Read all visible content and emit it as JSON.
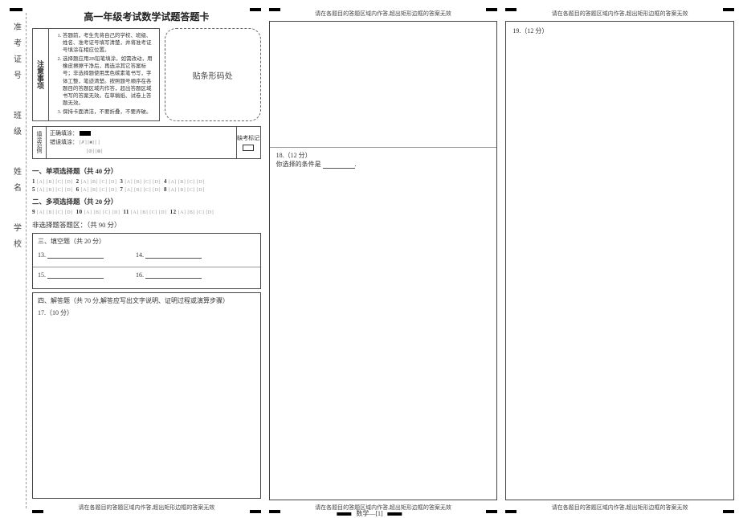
{
  "title": "高一年级考试数学试题答题卡",
  "notice": {
    "label": "注意事项",
    "items": [
      "答题前，考生先将自己的学校、班级、姓名、准考证号填写清楚，并将准考证号填涂在相应位置。",
      "选择题应用2B铅笔填涂，如需改动，用橡皮擦擦干净后，再选涂其它答案标号；非选择题使用黑色碳素笔书写，字体工整，笔迹清楚。按照题号顺序在各题目的答题区域内作答，超出答题区域书写的答案无效。在草稿纸、试卷上答题无效。",
      "保持卡面清洁，不要折叠，不要弄破。"
    ]
  },
  "barcode_label": "贴条形码处",
  "fill_example": {
    "label": "填涂范例",
    "correct": "正确填涂：",
    "wrong": "错误填涂：",
    "wrong_syms": "[✗] [■] [  ]",
    "wrong_syms2": "[⊘] [⊕]",
    "absent_label": "缺考标记"
  },
  "spine_labels": [
    "准考证号",
    "班级",
    "姓名",
    "学校"
  ],
  "sections": {
    "s1_head": "一、单项选择题（共 40 分）",
    "s2_head": "二、多项选择题（共 20 分）",
    "nonmc": "非选择题答题区：（共 90 分）",
    "s3_head": "三、填空题（共 20 分）",
    "s4_head": "四、解答题（共 70 分,解答应写出文字说明、证明过程或演算步骤）",
    "q13": "13.",
    "q14": "14.",
    "q15": "15.",
    "q16": "16.",
    "q17": "17.（10 分）",
    "q18": "18.（12 分）",
    "q18_prompt": "你选择的条件是",
    "q19": "19.（12 分）"
  },
  "mc": {
    "row1": {
      "n1": "1",
      "n2": "2",
      "n3": "3",
      "n4": "4"
    },
    "row2": {
      "n5": "5",
      "n6": "6",
      "n7": "7",
      "n8": "8"
    },
    "row3": {
      "n9": "9",
      "n10": "10",
      "n11": "11",
      "n12": "12"
    }
  },
  "bubbles4": "[A] [B] [C] [D]",
  "warn_text": "请在各题目的答题区域内作答,超出矩形边框的答案无效",
  "footer_page": "数学—[1]"
}
